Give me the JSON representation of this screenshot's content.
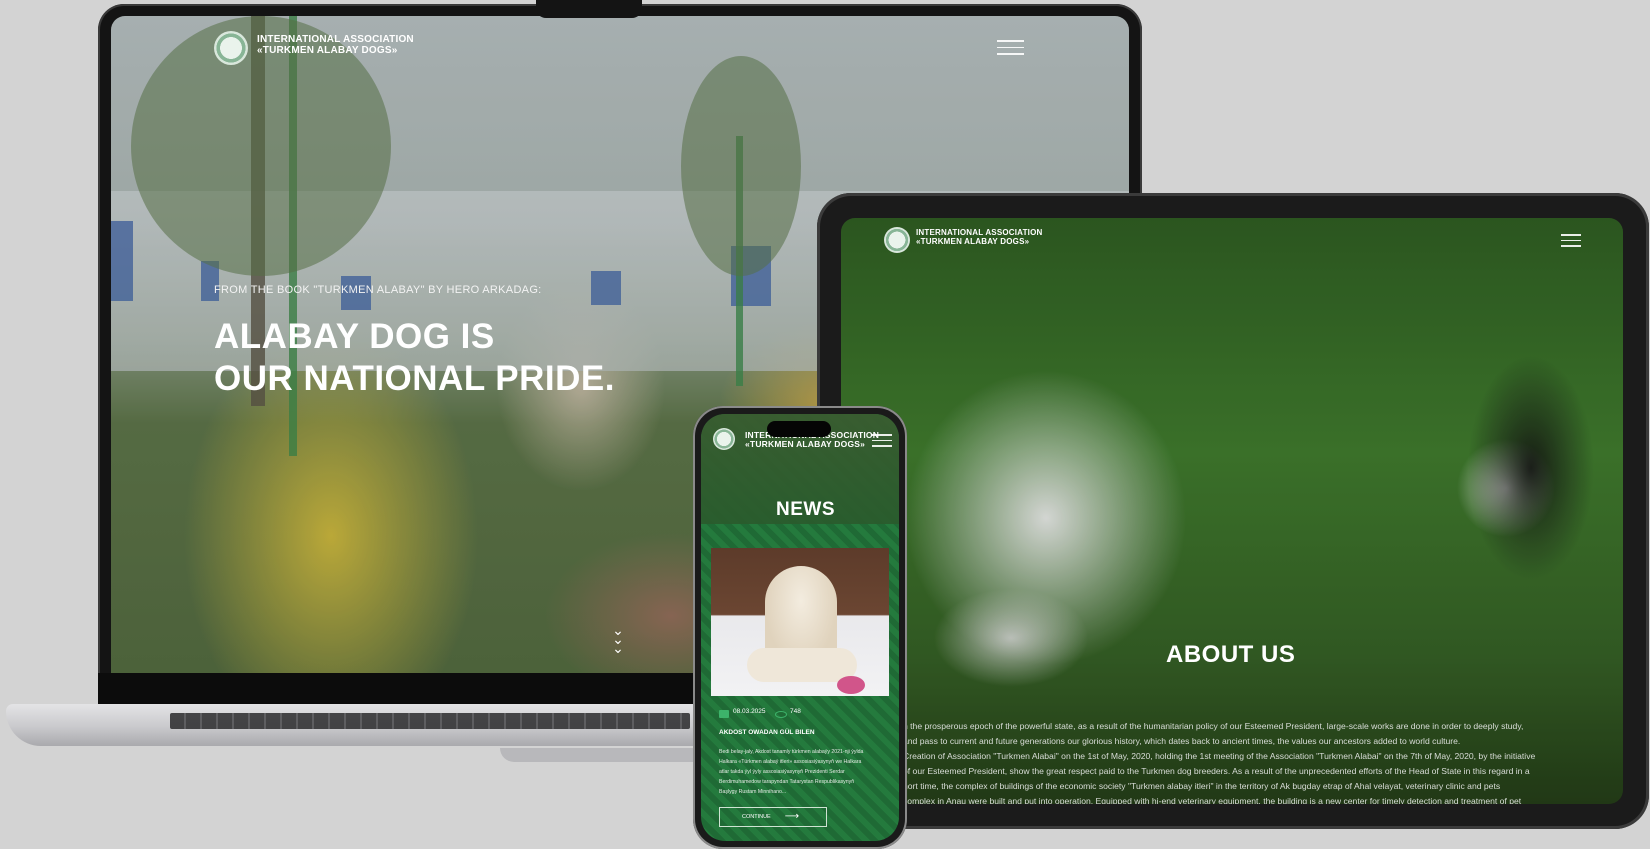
{
  "brand": {
    "line1": "INTERNATIONAL ASSOCIATION",
    "line2": "«TURKMEN ALABAY DOGS»"
  },
  "laptop": {
    "hero_subtitle": "FROM THE BOOK \"TURKMEN ALABAY\" BY HERO ARKADAG:",
    "hero_line1": "ALABAY DOG IS",
    "hero_line2": "OUR NATIONAL PRIDE."
  },
  "tablet": {
    "section_title": "ABOUT US",
    "paragraph_lines": [
      "n the prosperous epoch of the powerful state, as a result of the humanitarian policy of our Esteemed President, large-scale works are done in order to deeply study,",
      "and pass to current and future generations our glorious history, which dates back to ancient times, the values our ancestors added to world culture.",
      "Creation of Association \"Turkmen Alabai\" on the 1st of May, 2020, holding the 1st meeting of the Association \"Turkmen Alabai\" on the 7th of May, 2020, by the initiative",
      "of our Esteemed President, show the great respect paid to the Turkmen dog breeders. As a result of the unprecedented efforts of the Head of State in this regard in a",
      "hort time, the complex of buildings of the economic society \"Turkmen alabay itleri\" in the territory of Ak bugday etrap of Ahal velayat, veterinary clinic and pets",
      "complex in Anau were built and put into operation. Equipped with hi-end veterinary equipment, the building is a new center for timely detection and treatment of pet"
    ]
  },
  "phone": {
    "section_title": "NEWS",
    "date": "08.03.2025",
    "views": "748",
    "article_title": "AKDOST OWADAN GÜL BILEN",
    "article_lines": [
      "Bedi belay-jaly, Akdost tanamly türkmen alabaýy 2021-nji ýylda",
      "Halkara «Türkmen alabaý itleri» assosiasiýasynyň we Halkara",
      "atlar takda ýyl ýyly assosiasiýasynyň Prezidenti Serdar",
      "Berdimuhamedow tarapyndan Tatarystan Respublikasynyň",
      "Başlygy Rustam Minnihano..."
    ],
    "continue_label": "CONTINUE",
    "arrow_icon": "long-arrow-right-icon"
  },
  "colors": {
    "background": "#d3d3d3",
    "phone_green": "#1f6a35",
    "text_white": "#ffffff"
  }
}
